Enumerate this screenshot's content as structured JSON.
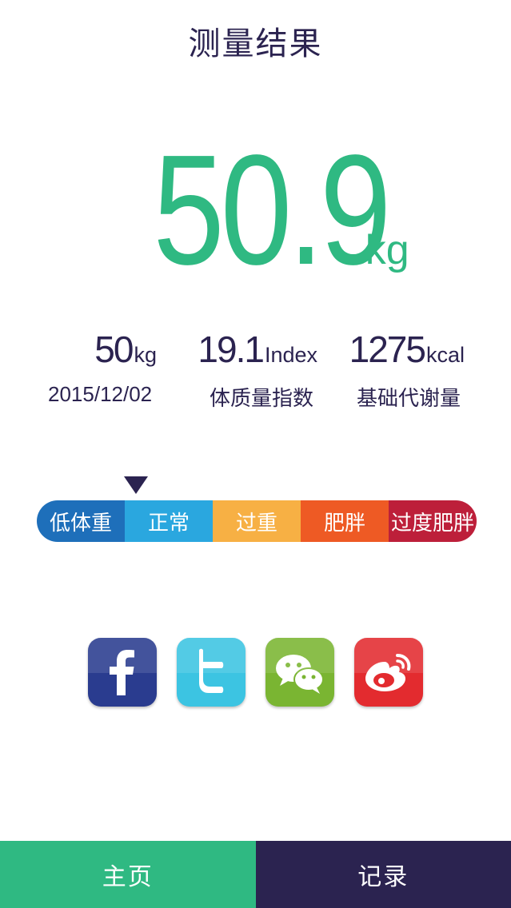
{
  "header": {
    "title": "测量结果"
  },
  "weight": {
    "value": "50.9",
    "unit": "kg"
  },
  "stats": [
    {
      "value": "50",
      "unit": "kg",
      "label": "2015/12/02"
    },
    {
      "value": "19.1",
      "unit": "Index",
      "label": "体质量指数"
    },
    {
      "value": "1275",
      "unit": "kcal",
      "label": "基础代谢量"
    }
  ],
  "bmi_scale": {
    "current_segment": "正常",
    "segments": [
      {
        "label": "低体重",
        "color": "#1e6fba"
      },
      {
        "label": "正常",
        "color": "#2aa7df"
      },
      {
        "label": "过重",
        "color": "#f7b044"
      },
      {
        "label": "肥胖",
        "color": "#ee5a24"
      },
      {
        "label": "过度肥胖",
        "color": "#bd1f3a"
      }
    ]
  },
  "share": {
    "buttons": [
      {
        "name": "facebook",
        "icon": "facebook-icon",
        "color": "#2a3c8f"
      },
      {
        "name": "twitter",
        "icon": "twitter-icon",
        "color": "#3cc4e2"
      },
      {
        "name": "wechat",
        "icon": "wechat-icon",
        "color": "#7ab532"
      },
      {
        "name": "weibo",
        "icon": "weibo-icon",
        "color": "#e32b2f"
      }
    ]
  },
  "nav": {
    "home_label": "主页",
    "records_label": "记录",
    "home_color": "#2fb982",
    "records_color": "#2b2350"
  },
  "accent_color": "#2fb982"
}
